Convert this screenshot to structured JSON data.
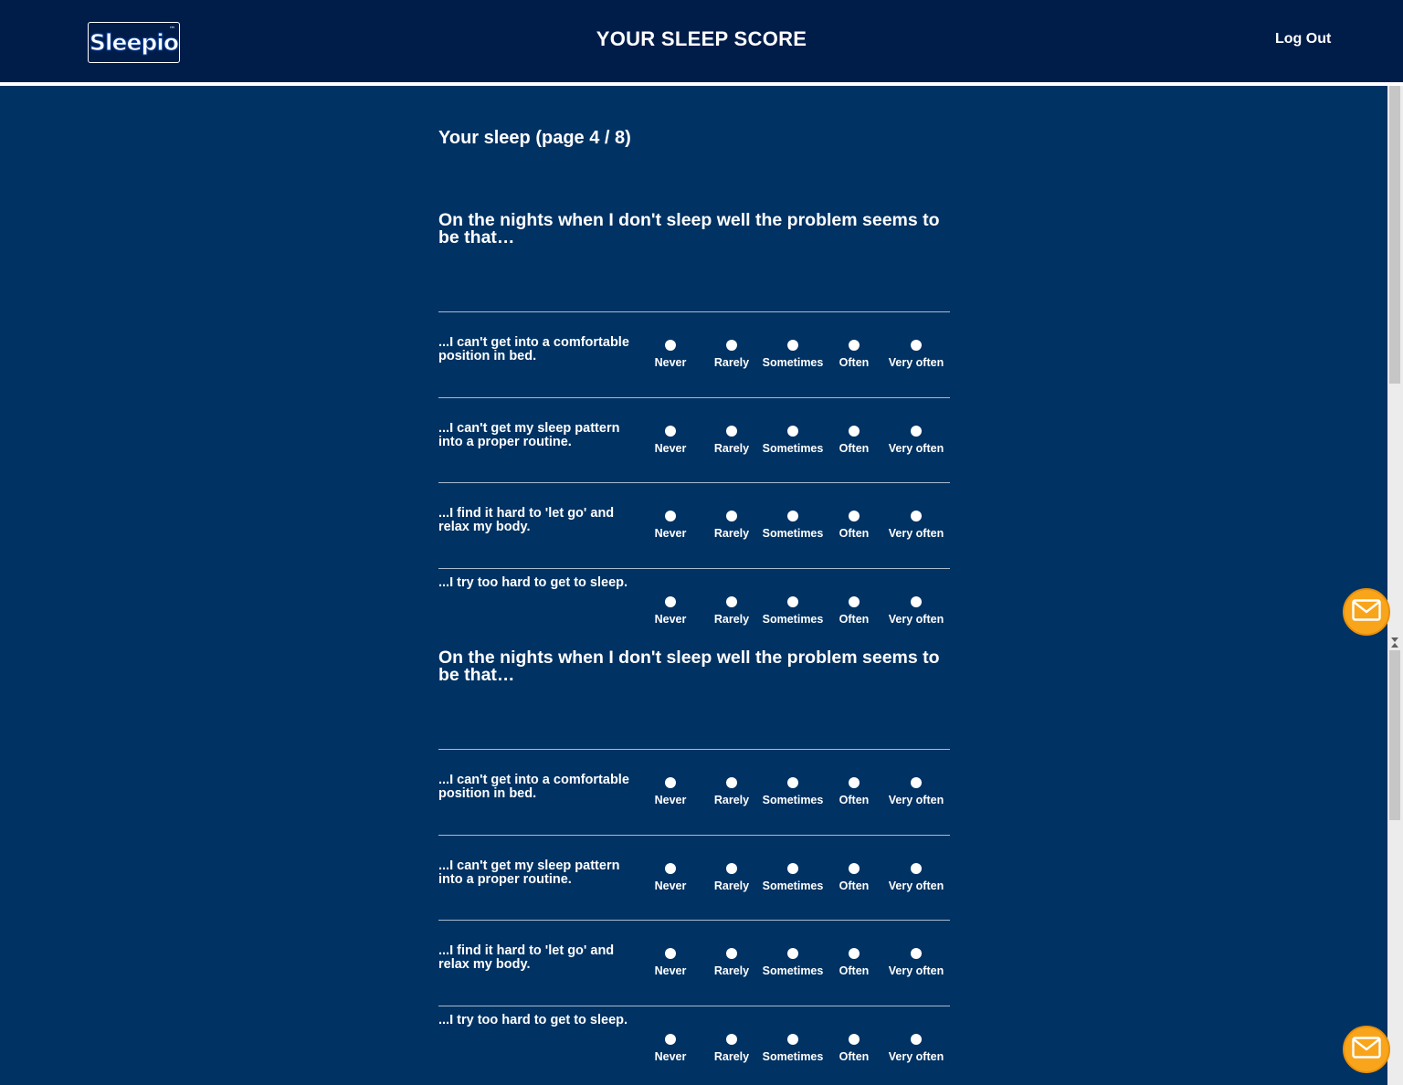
{
  "header": {
    "logo_text": "Sleepio",
    "logo_mark": "™",
    "title": "YOUR SLEEP SCORE",
    "logout_label": "Log Out"
  },
  "page": {
    "heading": "Your sleep (page 4 / 8)"
  },
  "options": [
    "Never",
    "Rarely",
    "Sometimes",
    "Often",
    "Very often"
  ],
  "sections": [
    {
      "heading": "On the nights when I don't sleep well the problem seems to be that…",
      "questions": [
        "...I can't get into a comfortable position in bed.",
        "...I can't get my sleep pattern into a proper routine.",
        "...I find it hard to 'let go' and relax my body.",
        "...I try too hard to get to sleep."
      ]
    },
    {
      "heading": "On the nights when I don't sleep well the problem seems to be that…",
      "questions": [
        "...I can't get into a comfortable position in bed.",
        "...I can't get my sleep pattern into a proper routine.",
        "...I find it hard to 'let go' and relax my body.",
        "...I try too hard to get to sleep."
      ]
    }
  ],
  "help": {
    "icon": "mail-icon"
  },
  "colors": {
    "header_bg": "#001d4a",
    "page_bg": "#003263",
    "accent": "#f9a51b"
  }
}
